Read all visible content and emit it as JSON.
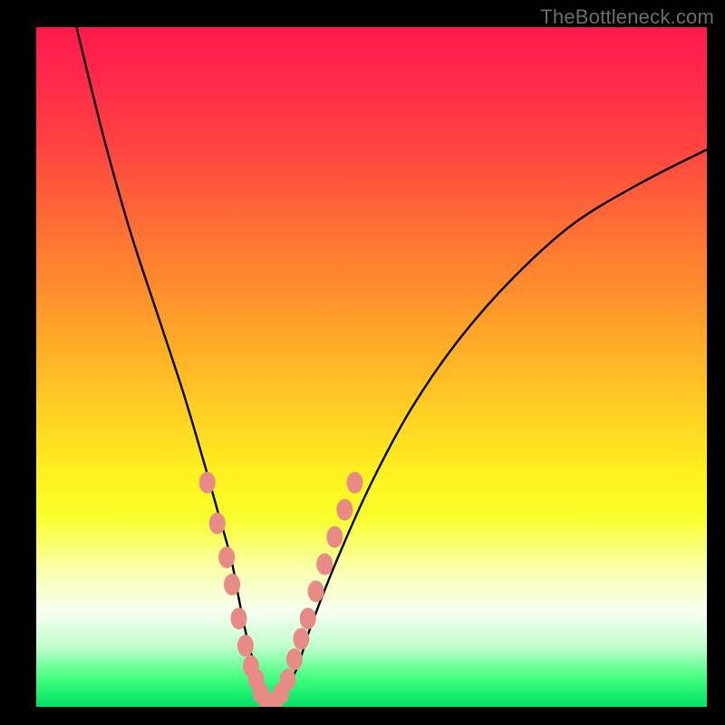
{
  "watermark": "TheBottleneck.com",
  "chart_data": {
    "type": "line",
    "title": "",
    "xlabel": "",
    "ylabel": "",
    "xlim": [
      0,
      100
    ],
    "ylim": [
      0,
      100
    ],
    "series": [
      {
        "name": "bottleneck-curve",
        "x": [
          6,
          10,
          14,
          18,
          22,
          25,
          27,
          29,
          30,
          31,
          32,
          33,
          34,
          35,
          36,
          37,
          39,
          41,
          45,
          50,
          56,
          63,
          71,
          80,
          90,
          100
        ],
        "values": [
          100,
          84,
          70,
          58,
          46,
          36,
          29,
          22,
          17,
          12,
          8,
          5,
          2,
          0,
          0,
          2,
          6,
          12,
          22,
          33,
          44,
          54,
          63,
          71,
          77,
          82
        ]
      }
    ],
    "markers": {
      "name": "curve-salmon-dots",
      "color": "#e88b87",
      "points": [
        {
          "x": 25.5,
          "y": 33
        },
        {
          "x": 27.0,
          "y": 27
        },
        {
          "x": 28.4,
          "y": 22
        },
        {
          "x": 29.2,
          "y": 18
        },
        {
          "x": 30.2,
          "y": 13
        },
        {
          "x": 31.2,
          "y": 9
        },
        {
          "x": 32.0,
          "y": 6
        },
        {
          "x": 32.8,
          "y": 4
        },
        {
          "x": 33.5,
          "y": 2
        },
        {
          "x": 34.5,
          "y": 0.5
        },
        {
          "x": 35.5,
          "y": 0.5
        },
        {
          "x": 36.5,
          "y": 2
        },
        {
          "x": 37.5,
          "y": 4
        },
        {
          "x": 38.5,
          "y": 7
        },
        {
          "x": 39.5,
          "y": 10
        },
        {
          "x": 40.5,
          "y": 13
        },
        {
          "x": 41.7,
          "y": 17
        },
        {
          "x": 43.0,
          "y": 21
        },
        {
          "x": 44.5,
          "y": 25
        },
        {
          "x": 46.0,
          "y": 29
        },
        {
          "x": 47.5,
          "y": 33
        }
      ]
    },
    "colors": {
      "curve": "#000000",
      "marker": "#e88b87",
      "background_top": "#ff1a4d",
      "background_bottom": "#00e066"
    }
  }
}
